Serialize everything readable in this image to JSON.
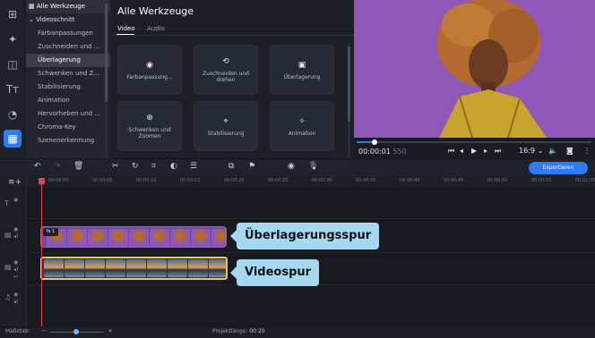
{
  "categories": {
    "root": "Alle Werkzeuge",
    "group": "Videoschnitt",
    "items": [
      "Farbanpassungen",
      "Zuschneiden und ...",
      "Überlagerung",
      "Schwenken und Z...",
      "Stabilisierung",
      "Animation",
      "Hervorheben und ...",
      "Chroma-Key",
      "Szenenerkennung"
    ]
  },
  "tools": {
    "title": "Alle Werkzeuge",
    "tabs": [
      "Video",
      "Audio"
    ],
    "tiles": [
      {
        "label": "Farbanpassung...",
        "icon": "color-icon"
      },
      {
        "label": "Zuschneiden und drehen",
        "icon": "crop-rotate-icon"
      },
      {
        "label": "Überlagerung",
        "icon": "overlay-icon"
      },
      {
        "label": "Schwenken und Zoomen",
        "icon": "pan-zoom-icon"
      },
      {
        "label": "Stabilisierung",
        "icon": "stabilize-icon"
      },
      {
        "label": "Animation",
        "icon": "animation-icon"
      }
    ]
  },
  "player": {
    "timecode": "00:00:01",
    "timecode_frames": "550",
    "aspect": "16:9",
    "progress": 0.08
  },
  "toolbar": {
    "export_label": "Exportieren"
  },
  "ruler": [
    "00:00:00",
    "00:00:05",
    "00:00:10",
    "00:00:15",
    "00:00:20",
    "00:00:25",
    "00:00:30",
    "00:00:35",
    "00:00:40",
    "00:00:45",
    "00:00:50",
    "00:00:55",
    "00:01:00"
  ],
  "timeline": {
    "fx_badge": "fx 1",
    "overlay_callout": "Überlagerungsspur",
    "video_callout": "Videospur"
  },
  "footer": {
    "scale_label": "Maßstab:",
    "length_label": "Projektlänge:",
    "length_value": "00:20"
  },
  "colors": {
    "accent": "#2f7bf5",
    "callout": "#a7d8f2",
    "video_border": "#f4c542",
    "preview_bg": "#8f57b7"
  }
}
